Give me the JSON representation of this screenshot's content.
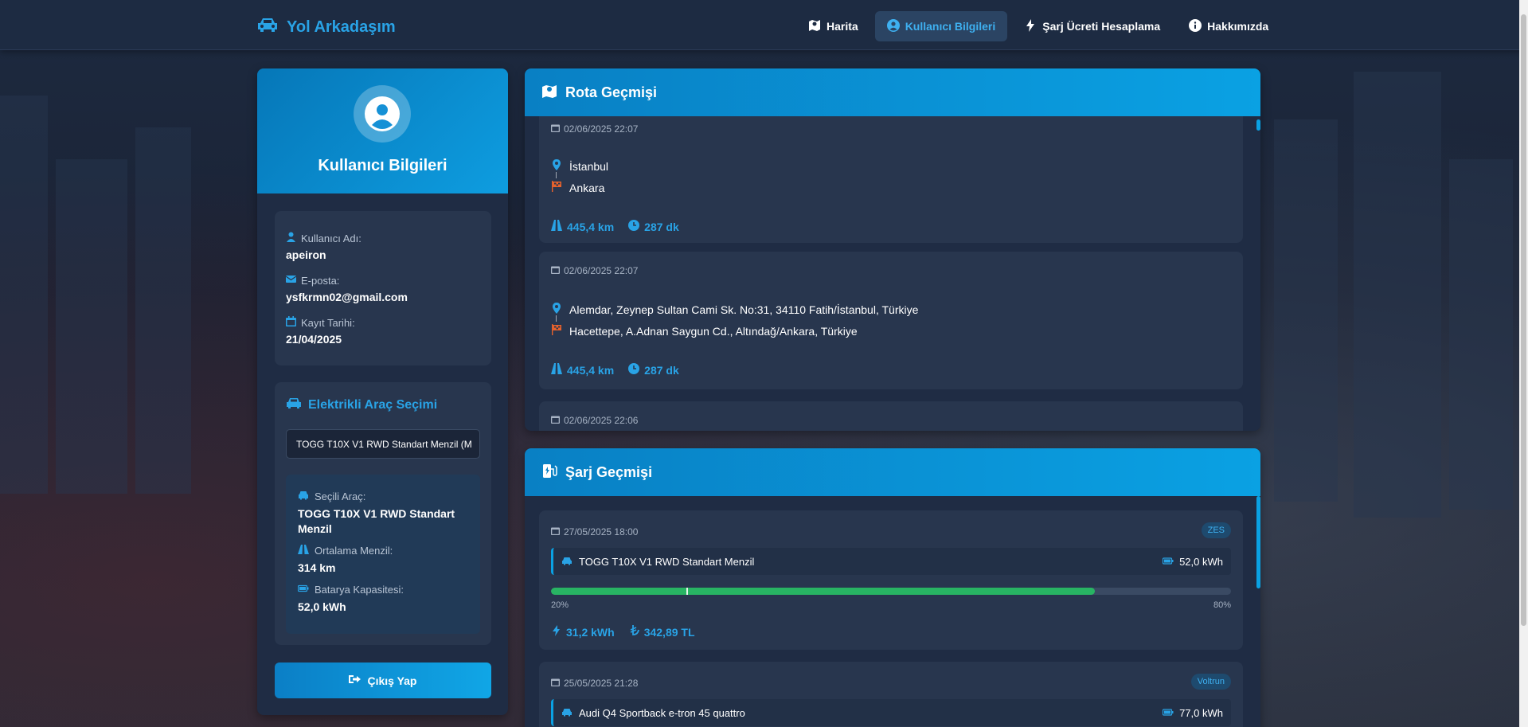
{
  "brand": {
    "name": "Yol Arkadaşım",
    "icon": "car-icon"
  },
  "nav": [
    {
      "label": "Harita",
      "icon": "map-icon",
      "active": false
    },
    {
      "label": "Kullanıcı Bilgileri",
      "icon": "user-circle-icon",
      "active": true
    },
    {
      "label": "Şarj Ücreti Hesaplama",
      "icon": "bolt-icon",
      "active": false
    },
    {
      "label": "Hakkımızda",
      "icon": "info-icon",
      "active": false
    }
  ],
  "profile": {
    "title": "Kullanıcı Bilgileri",
    "username_label": "Kullanıcı Adı:",
    "username": "apeiron",
    "email_label": "E-posta:",
    "email": "ysfkrmn02@gmail.com",
    "registered_label": "Kayıt Tarihi:",
    "registered": "21/04/2025"
  },
  "ev": {
    "title": "Elektrikli Araç Seçimi",
    "selected_option": "TOGG T10X V1 RWD Standart Menzil (M",
    "selected_label": "Seçili Araç:",
    "selected_vehicle": "TOGG T10X V1 RWD Standart Menzil",
    "range_label": "Ortalama Menzil:",
    "range": "314 km",
    "battery_label": "Batarya Kapasitesi:",
    "battery": "52,0 kWh"
  },
  "logout_label": "Çıkış Yap",
  "routes": {
    "title": "Rota Geçmişi",
    "items": [
      {
        "date": "02/06/2025 22:07",
        "from": "İstanbul",
        "to": "Ankara",
        "distance": "445,4 km",
        "duration": "287 dk"
      },
      {
        "date": "02/06/2025 22:07",
        "from": "Alemdar, Zeynep Sultan Cami Sk. No:31, 34110 Fatih/İstanbul, Türkiye",
        "to": "Hacettepe, A.Adnan Saygun Cd., Altındağ/Ankara, Türkiye",
        "distance": "445,4 km",
        "duration": "287 dk"
      },
      {
        "date": "02/06/2025 22:06"
      }
    ]
  },
  "charges": {
    "title": "Şarj Geçmişi",
    "items": [
      {
        "date": "27/05/2025 18:00",
        "provider": "ZES",
        "vehicle": "TOGG T10X V1 RWD Standart Menzil",
        "capacity": "52,0 kWh",
        "start_pct": "20%",
        "end_pct": "80%",
        "start": 0.2,
        "end": 0.8,
        "energy": "31,2 kWh",
        "cost": "342,89 TL"
      },
      {
        "date": "25/05/2025 21:28",
        "provider": "Voltrun",
        "vehicle": "Audi Q4 Sportback e-tron 45 quattro",
        "capacity": "77,0 kWh"
      }
    ]
  },
  "colors": {
    "accent": "#29a3e6",
    "header_gradient_start": "#0980c4",
    "header_gradient_end": "#0aa1e3",
    "progress": "#28b463",
    "destination": "#e8622c"
  }
}
